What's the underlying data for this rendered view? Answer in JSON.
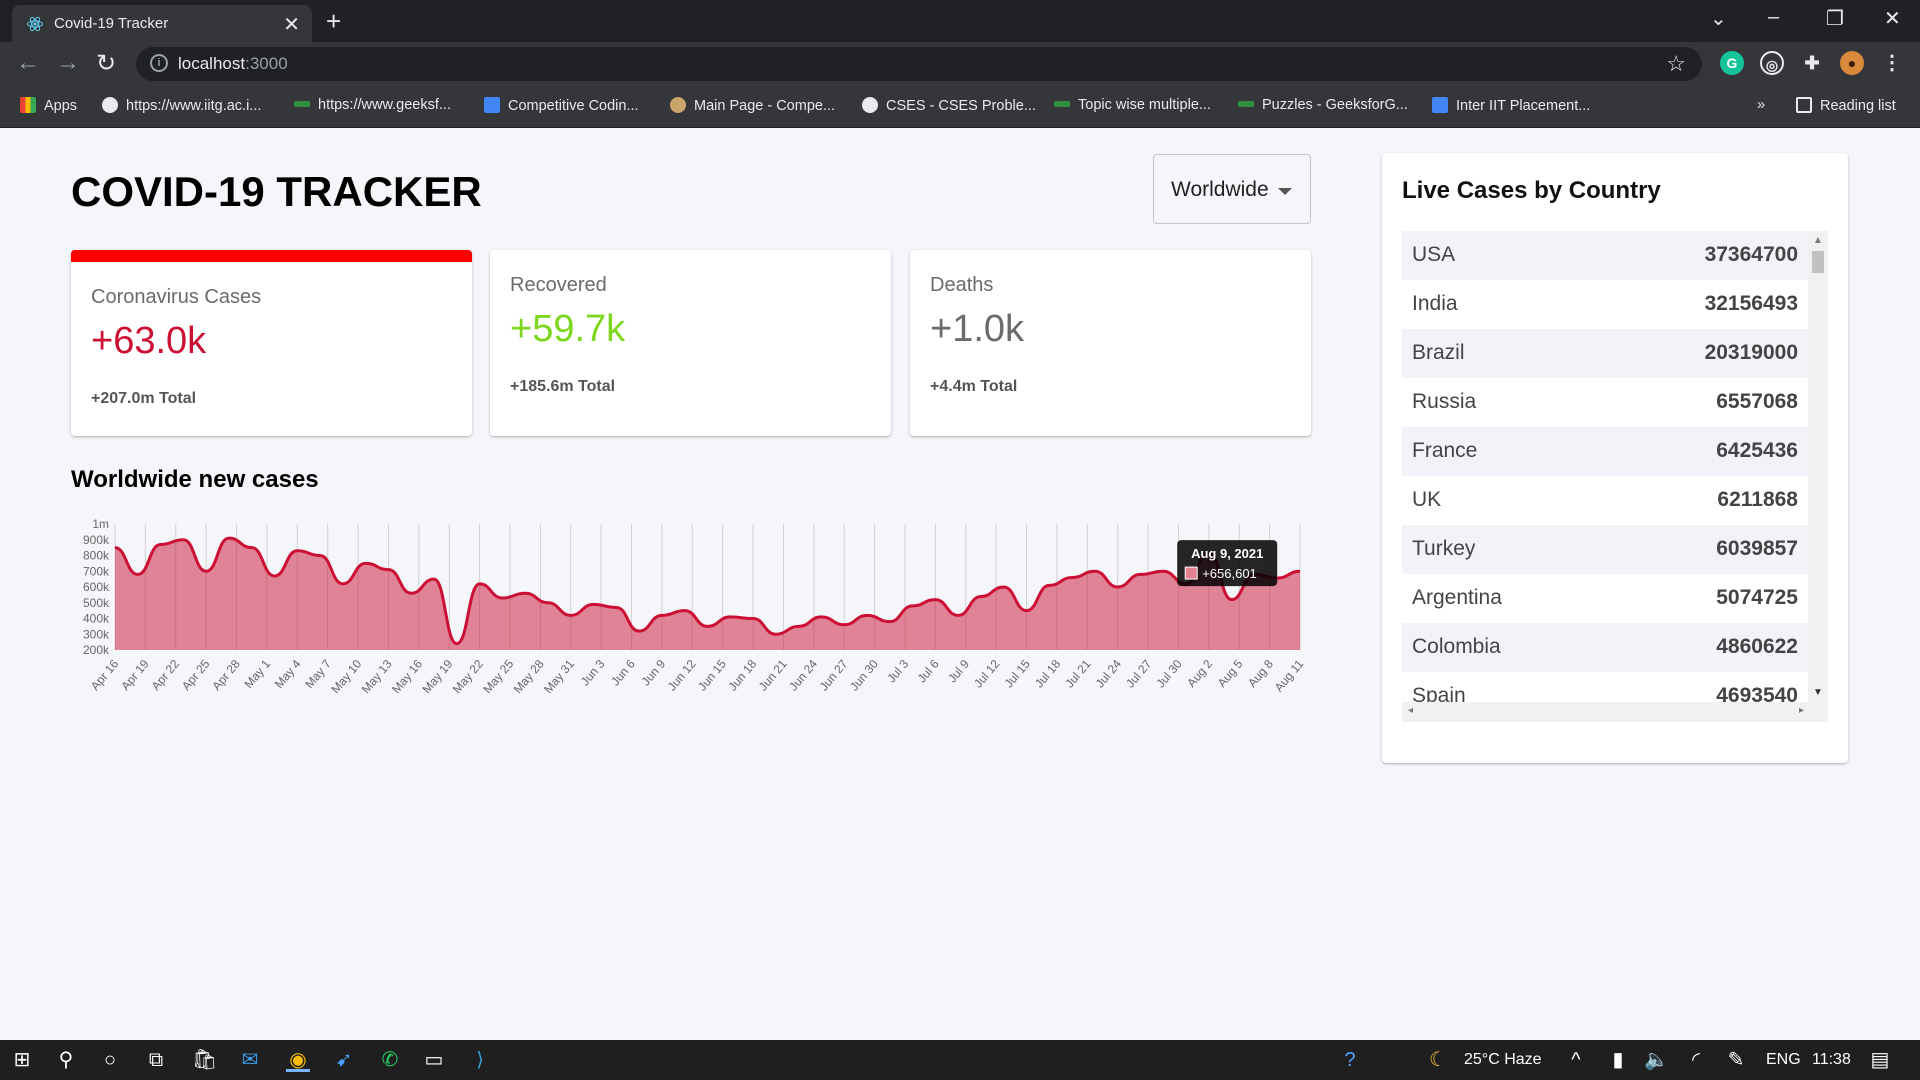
{
  "browser": {
    "tab_title": "Covid-19 Tracker",
    "url_host": "localhost",
    "url_port": ":3000",
    "bookmarks": [
      {
        "label": "Apps",
        "icon": "apps-grid-icon",
        "color": "#ea4335"
      },
      {
        "label": "https://www.iitg.ac.i...",
        "icon": "globe-icon",
        "color": "#e8eaed"
      },
      {
        "label": "https://www.geeksf...",
        "icon": "geeksforgeeks-icon",
        "color": "#2f8d46"
      },
      {
        "label": "Competitive Codin...",
        "icon": "docs-icon",
        "color": "#4285f4"
      },
      {
        "label": "Main Page - Compe...",
        "icon": "wiki-icon",
        "color": "#c9a46b"
      },
      {
        "label": "CSES - CSES Proble...",
        "icon": "globe-icon",
        "color": "#e8eaed"
      },
      {
        "label": "Topic wise multiple...",
        "icon": "geeksforgeeks-icon",
        "color": "#2f8d46"
      },
      {
        "label": "Puzzles - GeeksforG...",
        "icon": "geeksforgeeks-icon",
        "color": "#2f8d46"
      },
      {
        "label": "Inter IIT Placement...",
        "icon": "docs-icon",
        "color": "#4285f4"
      }
    ],
    "overflow": "»",
    "reading_list": "Reading list"
  },
  "app": {
    "title": "COVID-19 TRACKER",
    "country_select": "Worldwide",
    "cards": [
      {
        "title": "Coronavirus Cases",
        "value": "+63.0k",
        "total": "+207.0m  Total",
        "color": "#cc1034",
        "active": true
      },
      {
        "title": "Recovered",
        "value": "+59.7k",
        "total": "+185.6m  Total",
        "color": "#7dd71d",
        "active": false
      },
      {
        "title": "Deaths",
        "value": "+1.0k",
        "total": "+4.4m  Total",
        "color": "#6b6b6b",
        "active": false
      }
    ],
    "chart_title": "Worldwide new cases",
    "sidebar_title": "Live Cases by Country",
    "countries": [
      {
        "name": "USA",
        "cases": "37364700"
      },
      {
        "name": "India",
        "cases": "32156493"
      },
      {
        "name": "Brazil",
        "cases": "20319000"
      },
      {
        "name": "Russia",
        "cases": "6557068"
      },
      {
        "name": "France",
        "cases": "6425436"
      },
      {
        "name": "UK",
        "cases": "6211868"
      },
      {
        "name": "Turkey",
        "cases": "6039857"
      },
      {
        "name": "Argentina",
        "cases": "5074725"
      },
      {
        "name": "Colombia",
        "cases": "4860622"
      },
      {
        "name": "Spain",
        "cases": "4693540"
      }
    ]
  },
  "chart_data": {
    "type": "area",
    "title": "",
    "xlabel": "",
    "ylabel": "",
    "x_ticks": [
      "Apr 16",
      "Apr 19",
      "Apr 22",
      "Apr 25",
      "Apr 28",
      "May 1",
      "May 4",
      "May 7",
      "May 10",
      "May 13",
      "May 16",
      "May 19",
      "May 22",
      "May 25",
      "May 28",
      "May 31",
      "Jun 3",
      "Jun 6",
      "Jun 9",
      "Jun 12",
      "Jun 15",
      "Jun 18",
      "Jun 21",
      "Jun 24",
      "Jun 27",
      "Jun 30",
      "Jul 3",
      "Jul 6",
      "Jul 9",
      "Jul 12",
      "Jul 15",
      "Jul 18",
      "Jul 21",
      "Jul 24",
      "Jul 27",
      "Jul 30",
      "Aug 2",
      "Aug 5",
      "Aug 8",
      "Aug 11"
    ],
    "y_ticks": [
      "200k",
      "300k",
      "400k",
      "500k",
      "600k",
      "700k",
      "800k",
      "900k",
      "1m"
    ],
    "ylim": [
      200000,
      1000000
    ],
    "grid": "vertical",
    "series": [
      {
        "color": "#cc1034",
        "fill": "rgba(204,16,52,0.5)",
        "values": [
          850000,
          680000,
          870000,
          900000,
          700000,
          910000,
          850000,
          670000,
          830000,
          800000,
          620000,
          750000,
          710000,
          560000,
          650000,
          240000,
          620000,
          530000,
          560000,
          500000,
          420000,
          490000,
          470000,
          320000,
          420000,
          450000,
          350000,
          410000,
          400000,
          300000,
          350000,
          410000,
          360000,
          420000,
          380000,
          480000,
          520000,
          420000,
          540000,
          600000,
          450000,
          610000,
          660000,
          700000,
          600000,
          680000,
          700000,
          620000,
          820000,
          520000,
          680000,
          656601,
          700000
        ]
      }
    ],
    "tooltip": {
      "date": "Aug 9, 2021",
      "value": "+656,601"
    }
  },
  "taskbar": {
    "weather": "25°C  Haze",
    "lang": "ENG",
    "time": "11:38"
  }
}
